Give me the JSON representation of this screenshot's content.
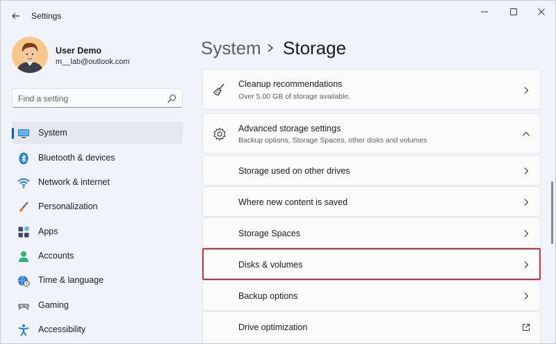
{
  "window": {
    "title": "Settings"
  },
  "profile": {
    "name": "User Demo",
    "email": "m__lab@outlook.com"
  },
  "search": {
    "placeholder": "Find a setting"
  },
  "nav": [
    {
      "label": "System",
      "icon": "monitor-icon",
      "active": true
    },
    {
      "label": "Bluetooth & devices",
      "icon": "bluetooth-icon"
    },
    {
      "label": "Network & internet",
      "icon": "wifi-icon"
    },
    {
      "label": "Personalization",
      "icon": "brush-icon"
    },
    {
      "label": "Apps",
      "icon": "apps-icon"
    },
    {
      "label": "Accounts",
      "icon": "person-icon"
    },
    {
      "label": "Time & language",
      "icon": "clock-globe-icon"
    },
    {
      "label": "Gaming",
      "icon": "gamepad-icon"
    },
    {
      "label": "Accessibility",
      "icon": "accessibility-icon"
    }
  ],
  "breadcrumb": {
    "parent": "System",
    "current": "Storage"
  },
  "cleanup": {
    "title": "Cleanup recommendations",
    "subtitle": "Over 5.00 GB of storage available."
  },
  "advanced": {
    "title": "Advanced storage settings",
    "subtitle": "Backup options, Storage Spaces, other disks and volumes",
    "items": [
      {
        "label": "Storage used on other drives",
        "action": "chevron-right-icon"
      },
      {
        "label": "Where new content is saved",
        "action": "chevron-right-icon"
      },
      {
        "label": "Storage Spaces",
        "action": "chevron-right-icon"
      },
      {
        "label": "Disks & volumes",
        "action": "chevron-right-icon",
        "highlighted": true
      },
      {
        "label": "Backup options",
        "action": "chevron-right-icon"
      },
      {
        "label": "Drive optimization",
        "action": "external-link-icon"
      }
    ]
  },
  "colors": {
    "accent": "#005fb8",
    "highlight": "#d32f3a",
    "background": "#f0f3f9"
  }
}
